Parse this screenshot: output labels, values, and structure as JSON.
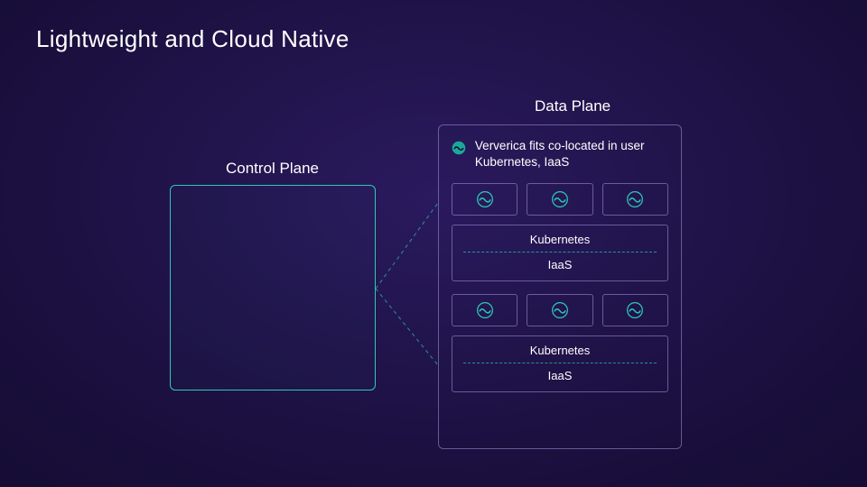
{
  "title": "Lightweight and Cloud Native",
  "colors": {
    "accent_teal": "#2dc9b5",
    "panel_border": "#a894dc"
  },
  "control_plane": {
    "label": "Control Plane"
  },
  "data_plane": {
    "label": "Data Plane",
    "description": "Ververica fits co-located in user Kubernetes, IaaS",
    "clusters": [
      {
        "kubernetes_label": "Kubernetes",
        "iaas_label": "IaaS",
        "node_count": 3
      },
      {
        "kubernetes_label": "Kubernetes",
        "iaas_label": "IaaS",
        "node_count": 3
      }
    ]
  },
  "icons": {
    "ververica": "ververica-logo-icon"
  }
}
